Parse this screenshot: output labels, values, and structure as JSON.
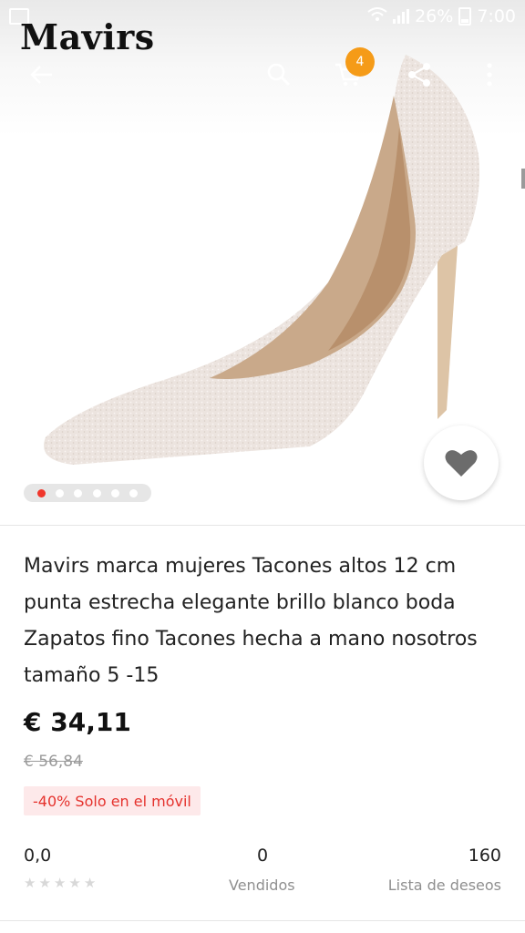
{
  "status_bar": {
    "battery": "26%",
    "time": "7:00"
  },
  "app": {
    "logo": "Mavirs"
  },
  "toolbar": {
    "cart_count": "4"
  },
  "product": {
    "title": "Mavirs marca mujeres Tacones altos 12 cm punta estrecha elegante brillo blanco boda Zapatos fino Tacones hecha a mano nosotros tamaño 5 -15",
    "price": "€ 34,11",
    "original_price": "€ 56,84",
    "promo": "-40% Solo en el móvil",
    "image_count": 6,
    "active_image": 1
  },
  "stats": {
    "rating": "0,0",
    "sold_value": "0",
    "sold_label": "Vendidos",
    "wishlist_value": "160",
    "wishlist_label": "Lista de deseos"
  }
}
